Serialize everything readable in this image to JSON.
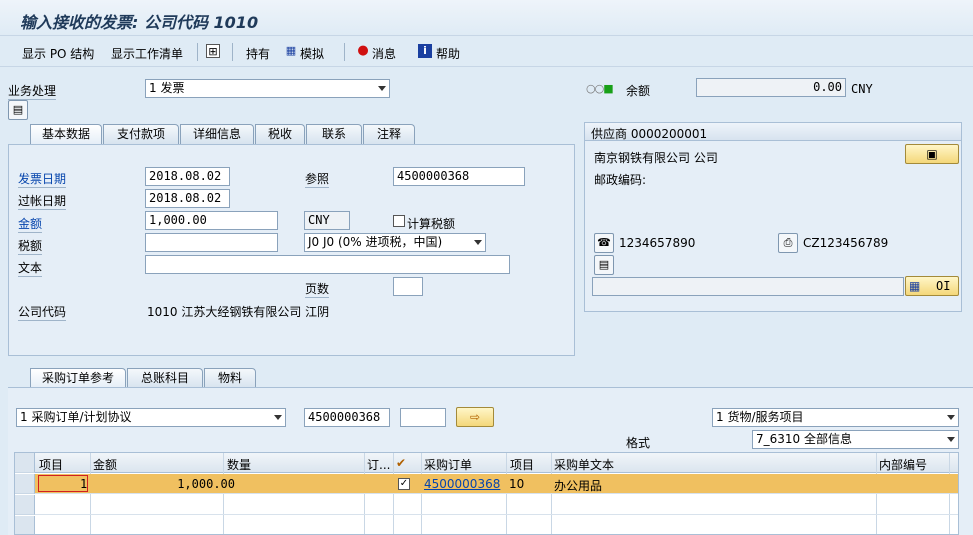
{
  "window": {
    "title": "输入接收的发票: 公司代码 1010"
  },
  "toolbar": {
    "show_po_structure": "显示 PO 结构",
    "show_worklist": "显示工作清单",
    "hold": "持有",
    "simulate": "模拟",
    "messages": "消息",
    "help": "帮助"
  },
  "header": {
    "transaction_label": "业务处理",
    "transaction_value": "1 发票",
    "balance_label": "余额",
    "balance_value": "0.00",
    "balance_currency": "CNY"
  },
  "tabs_top": [
    "基本数据",
    "支付款项",
    "详细信息",
    "税收",
    "联系",
    "注释"
  ],
  "basic": {
    "invoice_date_label": "发票日期",
    "invoice_date": "2018.08.02",
    "posting_date_label": "过帐日期",
    "posting_date": "2018.08.02",
    "amount_label": "金额",
    "amount": "1,000.00",
    "currency": "CNY",
    "calc_tax_label": "计算税额",
    "tax_label": "税额",
    "tax_code": "J0 J0 (0% 进项税，中国)",
    "text_label": "文本",
    "text_value": "",
    "reference_label": "参照",
    "reference_value": "4500000368",
    "pages_label": "页数",
    "pages_value": "",
    "company_label": "公司代码",
    "company_value": "1010 江苏大经钢铁有限公司 江阴"
  },
  "vendor": {
    "title": "供应商 0000200001",
    "name": "南京钢铁有限公司 公司",
    "postal_label": "邮政编码:",
    "phone": "1234657890",
    "tax_no": "CZ123456789",
    "oi_label": "OI"
  },
  "tabs_bottom": [
    "采购订单参考",
    "总账科目",
    "物料"
  ],
  "po_ref": {
    "type_value": "1 采购订单/计划协议",
    "po_number": "4500000368",
    "item_value": "",
    "layout_type": "1 货物/服务项目",
    "format_label": "格式",
    "format_value": "7_6310 全部信息"
  },
  "grid": {
    "headers": [
      "项目",
      "金额",
      "数量",
      "订...",
      "",
      "采购订单",
      "项目",
      "采购单文本",
      "内部编号"
    ],
    "rows": [
      {
        "item": "1",
        "amount": "1,000.00",
        "qty": "",
        "order_unit": "",
        "checked": true,
        "po": "4500000368",
        "po_item": "10",
        "text": "办公用品",
        "internal": ""
      }
    ]
  },
  "colors": {
    "accent": "#0645ad",
    "selected_row": "#f0c060",
    "button": "#f4d77a"
  }
}
